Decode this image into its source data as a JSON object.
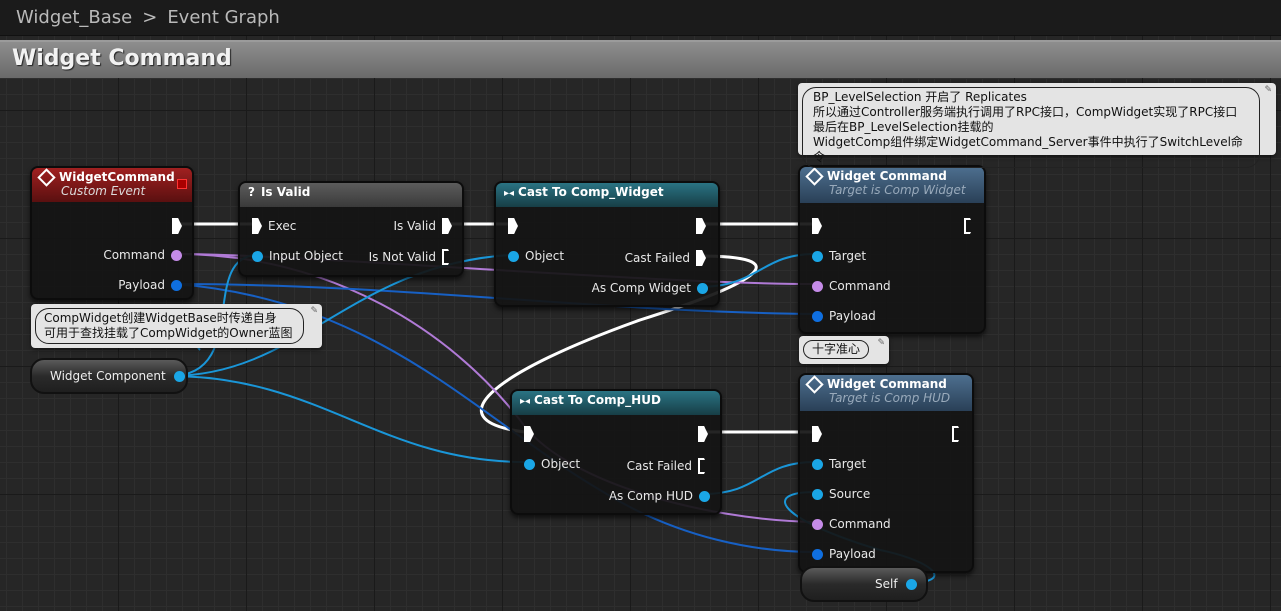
{
  "breadcrumb": {
    "root": "Widget_Base",
    "separator": ">",
    "current": "Event Graph"
  },
  "banner": {
    "title": "Widget Command"
  },
  "nodes": {
    "event": {
      "title": "WidgetCommand",
      "subtitle": "Custom Event",
      "pins": {
        "command": "Command",
        "payload": "Payload"
      }
    },
    "isvalid": {
      "title": "Is Valid",
      "pins": {
        "exec": "Exec",
        "input_object": "Input Object",
        "is_valid": "Is Valid",
        "is_not_valid": "Is Not Valid"
      }
    },
    "cast_widget": {
      "title": "Cast To Comp_Widget",
      "pins": {
        "object": "Object",
        "cast_failed": "Cast Failed",
        "as": "As Comp Widget"
      }
    },
    "cast_hud": {
      "title": "Cast To Comp_HUD",
      "pins": {
        "object": "Object",
        "cast_failed": "Cast Failed",
        "as": "As Comp HUD"
      }
    },
    "call_widget": {
      "title": "Widget Command",
      "subtitle": "Target is Comp Widget",
      "pins": {
        "target": "Target",
        "command": "Command",
        "payload": "Payload"
      }
    },
    "call_hud": {
      "title": "Widget Command",
      "subtitle": "Target is Comp HUD",
      "pins": {
        "target": "Target",
        "source": "Source",
        "command": "Command",
        "payload": "Payload"
      }
    },
    "widget_component": {
      "label": "Widget Component"
    },
    "self": {
      "label": "Self"
    }
  },
  "comments": {
    "top": [
      "BP_LevelSelection 开启了 Replicates",
      "所以通过Controller服务端执行调用了RPC接口，CompWidget实现了RPC接口",
      "最后在BP_LevelSelection挂载的",
      "WidgetComp组件绑定WidgetCommand_Server事件中执行了SwitchLevel命令"
    ],
    "left": [
      "CompWidget创建WidgetBase时传递自身",
      "可用于查找挂载了CompWidget的Owner蓝图"
    ],
    "crosshair": "十字准心"
  },
  "colors": {
    "event_header": "#8a1d1d",
    "pure_header": "#4a4a4a",
    "cast_header": "#1d5a66",
    "call_header": "#3a5a78",
    "object_pin": "#1aa6e6",
    "name_pin": "#c58be8",
    "struct_pin": "#0f6fe0"
  }
}
